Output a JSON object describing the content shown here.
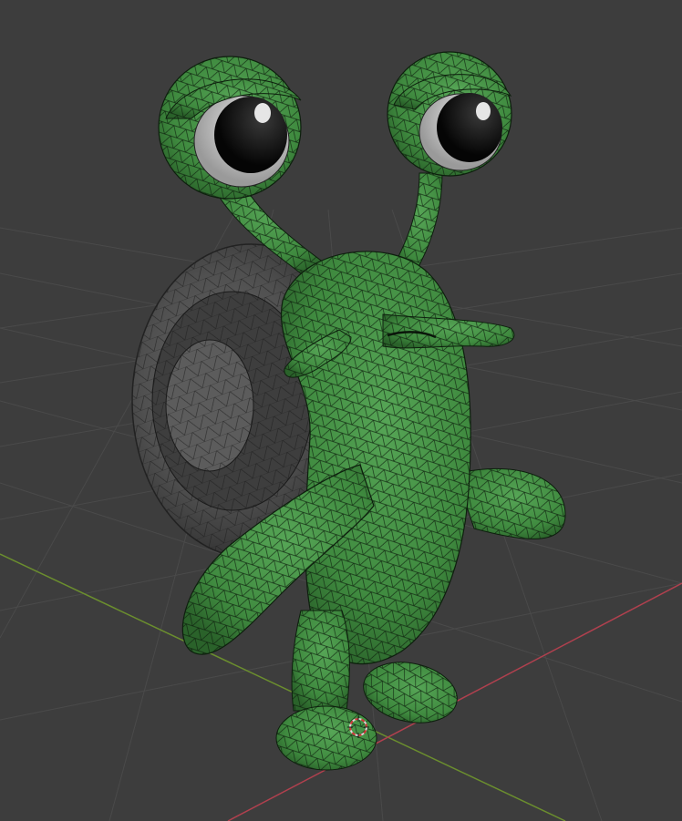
{
  "viewport": {
    "background": "#3d3d3d",
    "grid_color": "#4a4a4a",
    "x_axis_color": "#b0404e",
    "y_axis_color": "#6b8e2e"
  },
  "model": {
    "body_color": "#3f8a3f",
    "body_shadow": "#2c6a2c",
    "wire_color": "#0d1f0d",
    "shell_color": "#5a5a5a",
    "shell_dark": "#3a3a3a",
    "eye_white": "#d8d8d8",
    "pupil": "#111111",
    "display_mode": "solid-with-wireframe"
  },
  "cursor_3d": {
    "icon": "3d-cursor-icon",
    "ring_color_a": "#d9d9d9",
    "ring_color_b": "#d2363b"
  }
}
